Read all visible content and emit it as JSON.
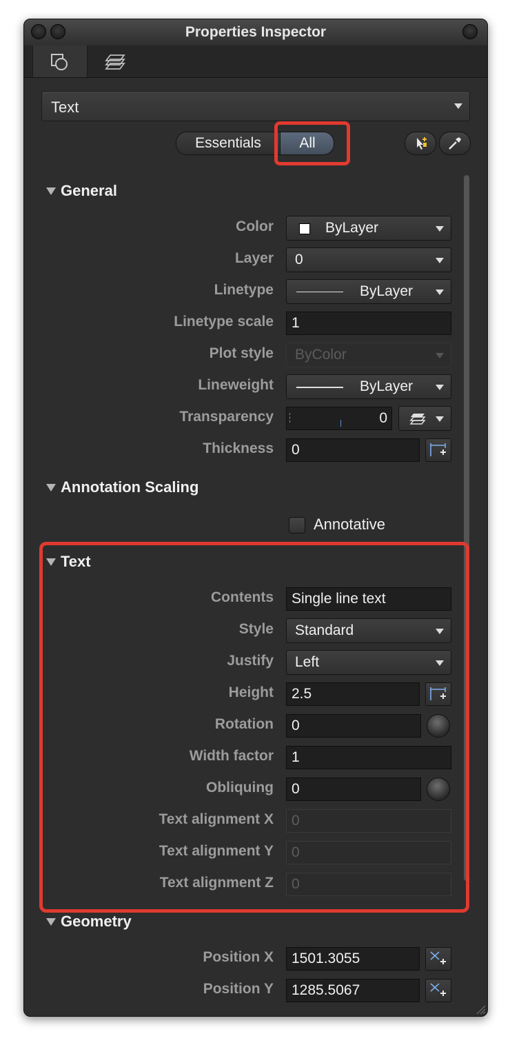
{
  "window": {
    "title": "Properties Inspector"
  },
  "tabs": [
    {
      "icon": "shapes-properties-icon",
      "active": true
    },
    {
      "icon": "layers-icon",
      "active": false
    }
  ],
  "object_type": "Text",
  "view_toggle": {
    "essentials": "Essentials",
    "all": "All",
    "selected": "All"
  },
  "toolbar_icons": [
    "quick-select-icon",
    "match-properties-icon"
  ],
  "general": {
    "title": "General",
    "color": {
      "label": "Color",
      "value": "ByLayer"
    },
    "layer": {
      "label": "Layer",
      "value": "0"
    },
    "linetype": {
      "label": "Linetype",
      "value": "ByLayer"
    },
    "linetype_scale": {
      "label": "Linetype scale",
      "value": "1"
    },
    "plot_style": {
      "label": "Plot style",
      "value": "ByColor"
    },
    "lineweight": {
      "label": "Lineweight",
      "value": "ByLayer"
    },
    "transparency": {
      "label": "Transparency",
      "value": "0"
    },
    "thickness": {
      "label": "Thickness",
      "value": "0"
    }
  },
  "annotation_scaling": {
    "title": "Annotation Scaling",
    "annotative": {
      "label": "Annotative",
      "checked": false
    }
  },
  "text": {
    "title": "Text",
    "contents": {
      "label": "Contents",
      "value": "Single line text"
    },
    "style": {
      "label": "Style",
      "value": "Standard"
    },
    "justify": {
      "label": "Justify",
      "value": "Left"
    },
    "height": {
      "label": "Height",
      "value": "2.5"
    },
    "rotation": {
      "label": "Rotation",
      "value": "0"
    },
    "width_factor": {
      "label": "Width factor",
      "value": "1"
    },
    "obliquing": {
      "label": "Obliquing",
      "value": "0"
    },
    "align_x": {
      "label": "Text alignment X",
      "value": "0"
    },
    "align_y": {
      "label": "Text alignment Y",
      "value": "0"
    },
    "align_z": {
      "label": "Text alignment Z",
      "value": "0"
    }
  },
  "geometry": {
    "title": "Geometry",
    "position_x": {
      "label": "Position X",
      "value": "1501.3055"
    },
    "position_y": {
      "label": "Position Y",
      "value": "1285.5067"
    }
  },
  "colors": {
    "highlight": "#e03a30",
    "panel": "#2d2d2d",
    "toggle_selected": "#4f5b6b"
  }
}
